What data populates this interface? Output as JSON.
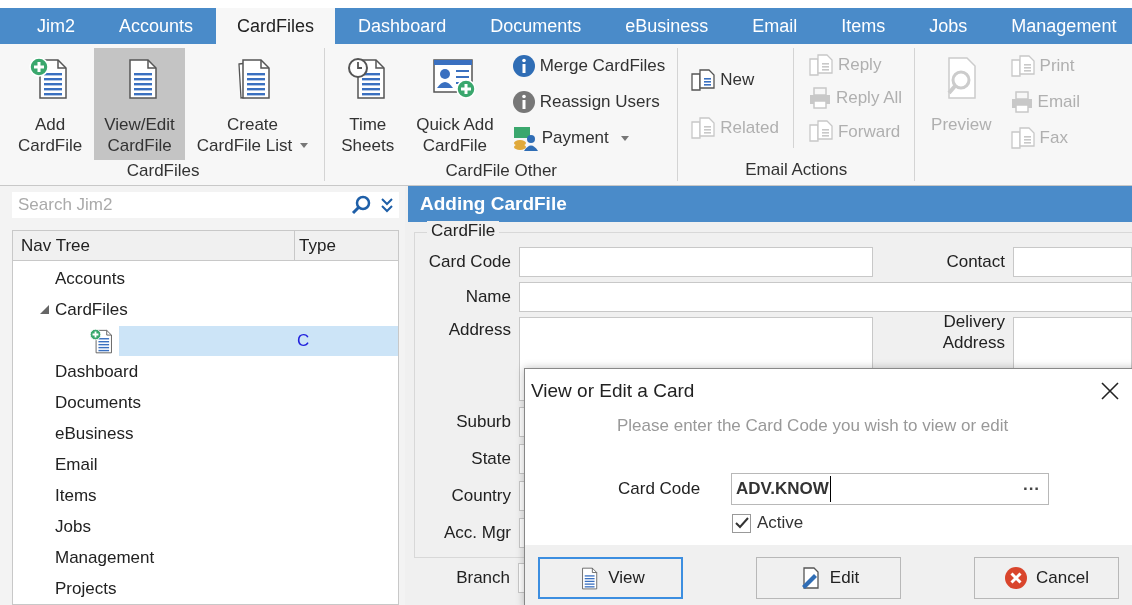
{
  "tabs": [
    {
      "label": "Jim2",
      "selected": false
    },
    {
      "label": "Accounts",
      "selected": false
    },
    {
      "label": "CardFiles",
      "selected": true
    },
    {
      "label": "Dashboard",
      "selected": false
    },
    {
      "label": "Documents",
      "selected": false
    },
    {
      "label": "eBusiness",
      "selected": false
    },
    {
      "label": "Email",
      "selected": false
    },
    {
      "label": "Items",
      "selected": false
    },
    {
      "label": "Jobs",
      "selected": false
    },
    {
      "label": "Management",
      "selected": false
    }
  ],
  "ribbon": {
    "groups": [
      {
        "label": "CardFiles",
        "items": [
          {
            "kind": "large",
            "lines": [
              "Add",
              "CardFile"
            ],
            "selected": false,
            "disabled": false
          },
          {
            "kind": "large",
            "lines": [
              "View/Edit",
              "CardFile"
            ],
            "selected": true,
            "disabled": false
          },
          {
            "kind": "large",
            "lines": [
              "Create",
              "CardFile List"
            ],
            "selected": false,
            "disabled": false,
            "dropdown": true
          }
        ]
      },
      {
        "label": "CardFile Other",
        "items": [
          {
            "kind": "large",
            "lines": [
              "Time",
              "Sheets"
            ],
            "selected": false,
            "disabled": false
          },
          {
            "kind": "large",
            "lines": [
              "Quick Add",
              "CardFile"
            ],
            "selected": false,
            "disabled": false
          },
          {
            "kind": "stack",
            "items": [
              {
                "label": "Merge CardFiles",
                "disabled": false
              },
              {
                "label": "Reassign Users",
                "disabled": false
              },
              {
                "label": "Payment",
                "disabled": false,
                "dropdown": true
              }
            ]
          }
        ]
      },
      {
        "label": "Email Actions",
        "items": [
          {
            "kind": "stack",
            "items": [
              {
                "label": "New",
                "disabled": false
              },
              {
                "label": "Related",
                "disabled": true
              }
            ]
          },
          {
            "kind": "stack",
            "items": [
              {
                "label": "Reply",
                "disabled": true
              },
              {
                "label": "Reply All",
                "disabled": true
              },
              {
                "label": "Forward",
                "disabled": true
              }
            ]
          }
        ]
      },
      {
        "items": [
          {
            "kind": "large",
            "lines": [
              "Preview"
            ],
            "selected": false,
            "disabled": true
          },
          {
            "kind": "stack",
            "items": [
              {
                "label": "Print",
                "disabled": true
              },
              {
                "label": "Email",
                "disabled": true
              },
              {
                "label": "Fax",
                "disabled": true
              }
            ]
          }
        ]
      }
    ]
  },
  "search": {
    "placeholder": "Search Jim2"
  },
  "nav_tree": {
    "columns": [
      "Nav Tree",
      "Type"
    ],
    "nodes": [
      {
        "label": "Accounts",
        "selected": false
      },
      {
        "label": "CardFiles",
        "selected": false,
        "expanded": true,
        "children": [
          {
            "type": "C",
            "selected": true
          }
        ]
      },
      {
        "label": "Dashboard",
        "selected": false
      },
      {
        "label": "Documents",
        "selected": false
      },
      {
        "label": "eBusiness",
        "selected": false
      },
      {
        "label": "Email",
        "selected": false
      },
      {
        "label": "Items",
        "selected": false
      },
      {
        "label": "Jobs",
        "selected": false
      },
      {
        "label": "Management",
        "selected": false
      },
      {
        "label": "Projects",
        "selected": false
      }
    ]
  },
  "form": {
    "title": "Adding CardFile",
    "group": "CardFile",
    "card_code": "Card Code",
    "contact": "Contact",
    "name": "Name",
    "address": "Address",
    "delivery_address": [
      "Delivery",
      "Address"
    ],
    "lower_fields": [
      "Suburb",
      "State",
      "Country",
      "Acc. Mgr"
    ],
    "branch": "Branch"
  },
  "dialog": {
    "title": "View or Edit a Card",
    "message": "Please enter the Card Code you wish to view or edit",
    "card_code": {
      "label": "Card Code",
      "value": "ADV.KNOW",
      "browse": "···"
    },
    "active": {
      "label": "Active",
      "checked": true
    },
    "buttons": [
      {
        "kind": "view",
        "label": "View",
        "focused": true
      },
      {
        "kind": "edit",
        "label": "Edit",
        "focused": false
      },
      {
        "kind": "cancel",
        "label": "Cancel",
        "focused": false
      }
    ]
  }
}
